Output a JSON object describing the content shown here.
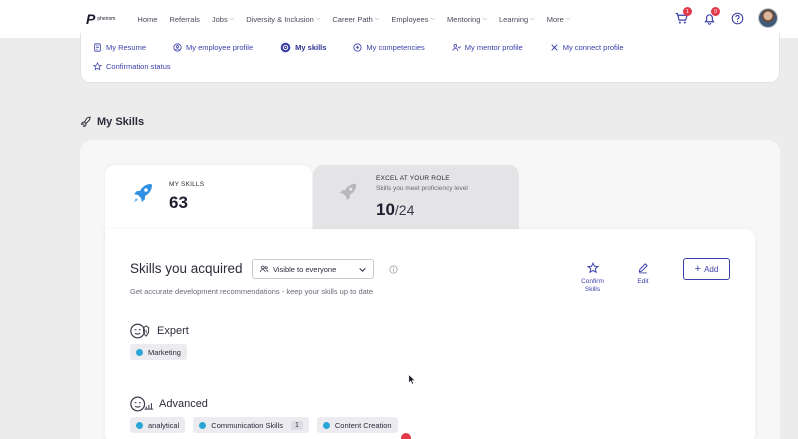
{
  "nav": {
    "logo_mark": "P",
    "logo_text": "phenom",
    "items": [
      {
        "label": "Home",
        "has_menu": false
      },
      {
        "label": "Referrals",
        "has_menu": false
      },
      {
        "label": "Jobs",
        "has_menu": true
      },
      {
        "label": "Diversity & Inclusion",
        "has_menu": true
      },
      {
        "label": "Career Path",
        "has_menu": true
      },
      {
        "label": "Employees",
        "has_menu": true
      },
      {
        "label": "Mentoring",
        "has_menu": true
      },
      {
        "label": "Learning",
        "has_menu": true
      },
      {
        "label": "More",
        "has_menu": true
      }
    ],
    "cart_badge": "1",
    "bell_badge": "0"
  },
  "profile_links": [
    {
      "label": "My Resume",
      "icon": "resume-icon",
      "active": false
    },
    {
      "label": "My employee profile",
      "icon": "profile-icon",
      "active": false
    },
    {
      "label": "My skills",
      "icon": "skills-icon",
      "active": true
    },
    {
      "label": "My competencies",
      "icon": "competency-icon",
      "active": false
    },
    {
      "label": "My mentor profile",
      "icon": "mentor-icon",
      "active": false
    },
    {
      "label": "My connect profile",
      "icon": "connect-icon",
      "active": false
    }
  ],
  "confirmation_link": "Confirmation status",
  "section_title": "My Skills",
  "tabs": {
    "my_skills": {
      "label": "MY SKILLS",
      "value": "63"
    },
    "excel": {
      "label": "EXCEL AT YOUR ROLE",
      "sub": "Skills you meet proficiency level",
      "value": "10",
      "total": "/24"
    }
  },
  "skills": {
    "heading": "Skills you acquired",
    "visibility": "Visible to everyone",
    "hint": "Get accurate development recommendations - keep your skills up to date",
    "confirm_label": "Confirm Skills",
    "edit_label": "Edit",
    "add_label": "Add",
    "levels": [
      {
        "name": "Expert",
        "chips": [
          {
            "label": "Marketing",
            "count": ""
          }
        ]
      },
      {
        "name": "Advanced",
        "chips": [
          {
            "label": "analytical",
            "count": ""
          },
          {
            "label": "Communication Skills",
            "count": "1"
          },
          {
            "label": "Content Creation",
            "count": ""
          }
        ]
      }
    ]
  },
  "colors": {
    "accent": "#3b3fa8",
    "chip_dot": "#2aa6d6",
    "badge": "#e23a4a"
  }
}
